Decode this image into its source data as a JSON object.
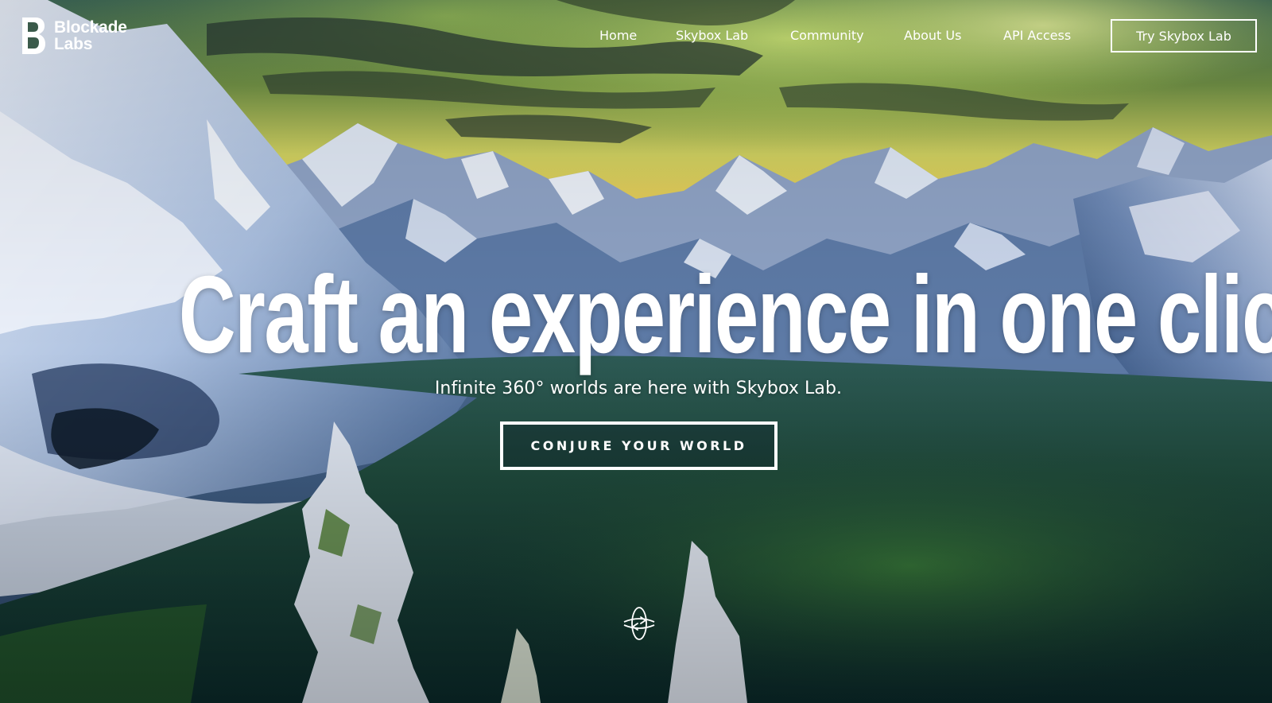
{
  "brand": {
    "name_line1": "Blockade",
    "name_line2": "Labs",
    "icon": "blockade-logo-icon"
  },
  "nav": {
    "items": [
      {
        "label": "Home"
      },
      {
        "label": "Skybox Lab"
      },
      {
        "label": "Community"
      },
      {
        "label": "About Us"
      },
      {
        "label": "API Access"
      }
    ],
    "cta_label": "Try Skybox Lab"
  },
  "hero": {
    "headline": "Craft an experience in one click",
    "subheadline": "Infinite 360° worlds are here with Skybox Lab.",
    "cta_label": "CONJURE YOUR WORLD",
    "icon": "360-orbit-icon",
    "background": "snowy-mountains-aurora-lake"
  },
  "colors": {
    "text": "#ffffff",
    "aurora_green": "#b6e05a",
    "sky_yellow": "#e8d45a",
    "water_deep": "#0d3a3a",
    "mountain_blue": "#4d6f9c"
  }
}
